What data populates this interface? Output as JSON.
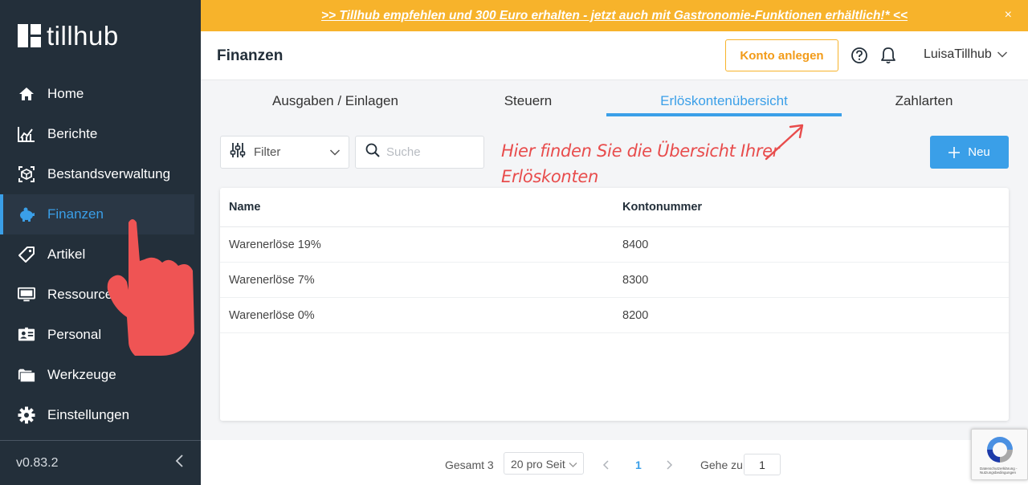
{
  "brand": {
    "name": "tillhub"
  },
  "banner": {
    "text": ">> Tillhub empfehlen und 300 Euro erhalten - jetzt auch mit Gastronomie-Funktionen erhältlich!* <<",
    "close": "×"
  },
  "sidebar": {
    "items": [
      {
        "label": "Home",
        "icon": "home-icon"
      },
      {
        "label": "Berichte",
        "icon": "chart-icon"
      },
      {
        "label": "Bestandsverwaltung",
        "icon": "inventory-icon"
      },
      {
        "label": "Finanzen",
        "icon": "piggy-bank-icon",
        "active": true
      },
      {
        "label": "Artikel",
        "icon": "tag-icon"
      },
      {
        "label": "Ressourcen",
        "icon": "monitor-icon"
      },
      {
        "label": "Personal",
        "icon": "id-card-icon"
      },
      {
        "label": "Werkzeuge",
        "icon": "folder-icon"
      },
      {
        "label": "Einstellungen",
        "icon": "gear-icon"
      }
    ],
    "version": "v0.83.2"
  },
  "header": {
    "title": "Finanzen",
    "konto_button": "Konto anlegen",
    "user": "LuisaTillhub"
  },
  "tabs": [
    {
      "label": "Ausgaben / Einlagen"
    },
    {
      "label": "Steuern"
    },
    {
      "label": "Erlöskontenübersicht",
      "active": true
    },
    {
      "label": "Zahlarten"
    }
  ],
  "toolbar": {
    "filter_label": "Filter",
    "search_placeholder": "Suche",
    "new_button": "Neu"
  },
  "annotation": {
    "text": "Hier finden Sie die Übersicht Ihrer Erlöskonten"
  },
  "table": {
    "columns": [
      "Name",
      "Kontonummer"
    ],
    "rows": [
      {
        "name": "Warenerlöse 19%",
        "number": "8400"
      },
      {
        "name": "Warenerlöse 7%",
        "number": "8300"
      },
      {
        "name": "Warenerlöse 0%",
        "number": "8200"
      }
    ]
  },
  "pagination": {
    "total": "Gesamt 3",
    "page_size": "20 pro Seit",
    "current_page": "1",
    "goto_label": "Gehe zu",
    "goto_value": "1"
  },
  "recaptcha": {
    "text": "Datenschutzerklärung - Nutzungsbedingungen"
  },
  "colors": {
    "sidebar": "#232f3a",
    "accent": "#3a9fe8",
    "banner": "#f7b32b",
    "annotation": "#e84c4c"
  }
}
